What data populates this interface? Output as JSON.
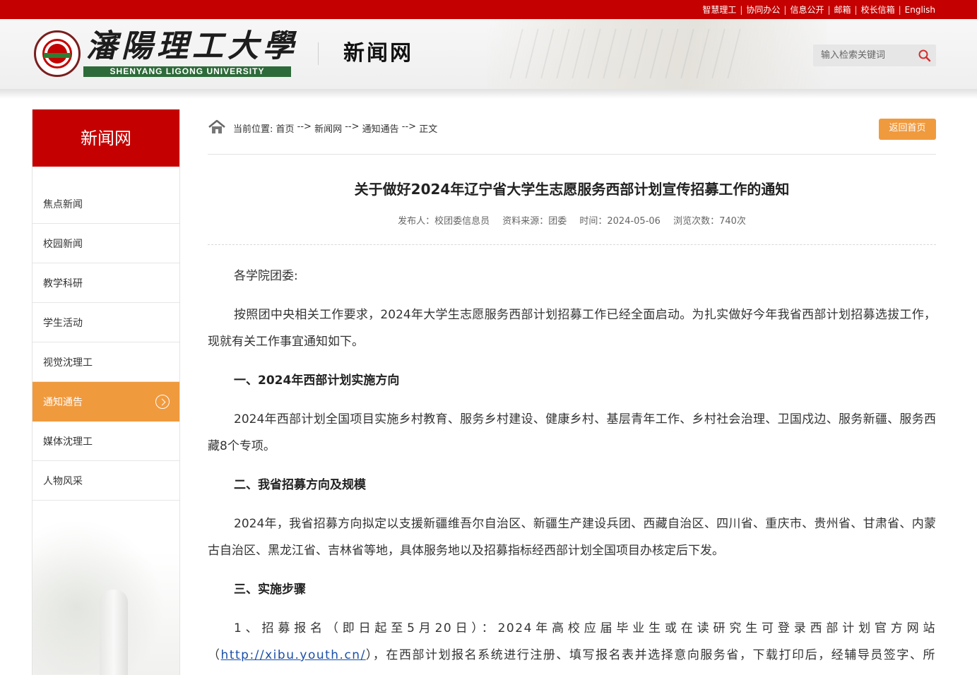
{
  "topbar": {
    "links": [
      "智慧理工",
      "协同办公",
      "信息公开",
      "邮箱",
      "校长信箱",
      "English"
    ],
    "separator": "|"
  },
  "header": {
    "school_name_cn": "瀋陽理工大學",
    "school_name_en": "SHENYANG LIGONG UNIVERSITY",
    "site_name": "新闻网",
    "search_placeholder": "输入检索关键词",
    "search_icon": "search-icon"
  },
  "sidebar": {
    "title": "新闻网",
    "items": [
      {
        "label": "焦点新闻",
        "active": false
      },
      {
        "label": "校园新闻",
        "active": false
      },
      {
        "label": "教学科研",
        "active": false
      },
      {
        "label": "学生活动",
        "active": false
      },
      {
        "label": "视觉沈理工",
        "active": false
      },
      {
        "label": "通知通告",
        "active": true
      },
      {
        "label": "媒体沈理工",
        "active": false
      },
      {
        "label": "人物风采",
        "active": false
      }
    ]
  },
  "breadcrumb": {
    "prefix": "当前位置: ",
    "items": [
      "首页",
      "新闻网",
      "通知通告",
      "正文"
    ],
    "separator": " --> ",
    "back_button": "返回首页"
  },
  "article": {
    "title": "关于做好2024年辽宁省大学生志愿服务西部计划宣传招募工作的通知",
    "meta": {
      "publisher": "发布人：校团委信息员",
      "source": "资料来源：团委",
      "time": "时间：2024-05-06",
      "views": "浏览次数：740次"
    },
    "salutation": "各学院团委:",
    "para1": "按照团中央相关工作要求，2024年大学生志愿服务西部计划招募工作已经全面启动。为扎实做好今年我省西部计划招募选拔工作，现就有关工作事宜通知如下。",
    "heading1": "一、2024年西部计划实施方向",
    "para2": "2024年西部计划全国项目实施乡村教育、服务乡村建设、健康乡村、基层青年工作、乡村社会治理、卫国戍边、服务新疆、服务西藏8个专项。",
    "heading2": "二、我省招募方向及规模",
    "para3": "2024年，我省招募方向拟定以支援新疆维吾尔自治区、新疆生产建设兵团、西藏自治区、四川省、重庆市、贵州省、甘肃省、内蒙古自治区、黑龙江省、吉林省等地，具体服务地以及招募指标经西部计划全国项目办核定后下发。",
    "heading3": "三、实施步骤",
    "para4_before_link": "1、招募报名（即日起至5月20日）：2024年高校应届毕业生或在读研究生可登录西部计划官方网站（",
    "para4_link": "http://xibu.youth.cn/",
    "para4_after_link": "），在西部计划报名系统进行注册、填写报名表并选择意向服务省，下载打印后，经辅导员签字、所在院系团委审核同意后"
  },
  "colors": {
    "brand_red": "#c40000",
    "accent_orange": "#f09a3e",
    "link_blue": "#1a4ea8"
  }
}
